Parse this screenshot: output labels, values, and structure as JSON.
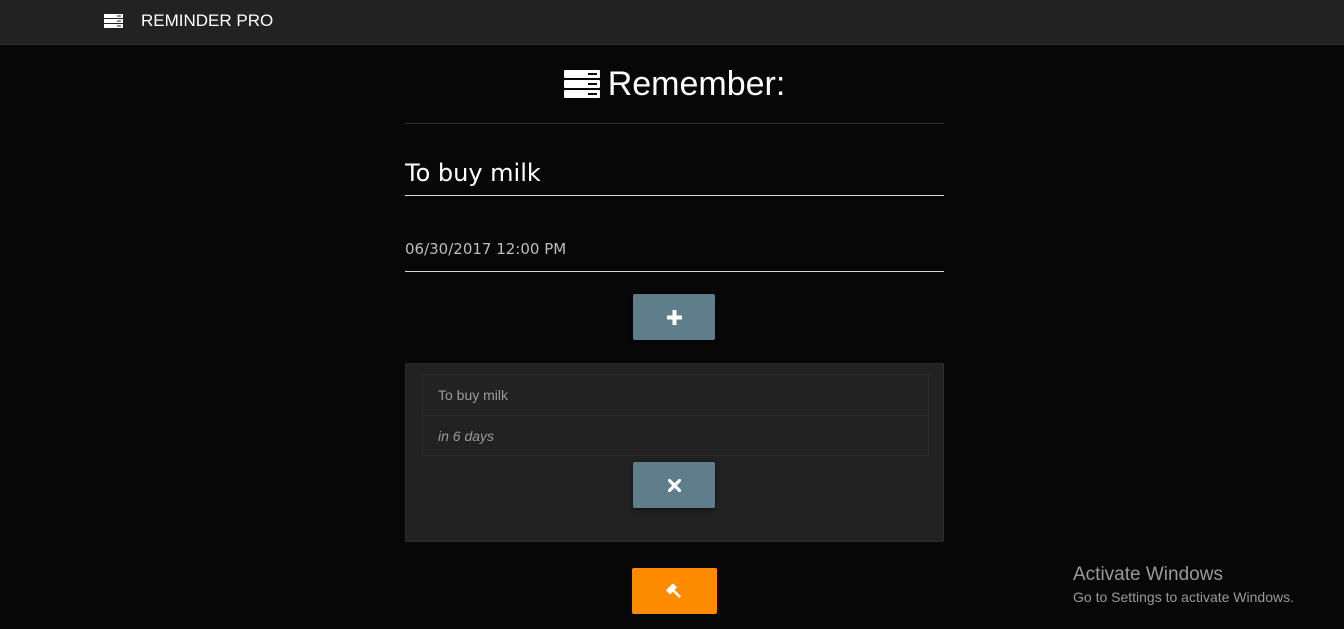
{
  "app": {
    "brand": "REMINDER PRO",
    "brand_icon": "server-stack-icon"
  },
  "header": {
    "title": "Remember:",
    "title_icon": "server-stack-icon"
  },
  "form": {
    "reminder_text_value": "To buy milk",
    "datetime_value": "06/30/2017 12:00 PM",
    "add_button_icon": "plus-icon"
  },
  "reminders": [
    {
      "text": "To buy milk",
      "due": "in 6 days",
      "delete_button_icon": "close-icon"
    }
  ],
  "clear_button_icon": "gavel-icon",
  "watermark": {
    "title": "Activate Windows",
    "subtitle": "Go to Settings to activate Windows."
  },
  "colors": {
    "navbar_bg": "#222222",
    "page_bg": "#070707",
    "button_primary": "#607d8b",
    "button_clear": "#ff8c00"
  }
}
